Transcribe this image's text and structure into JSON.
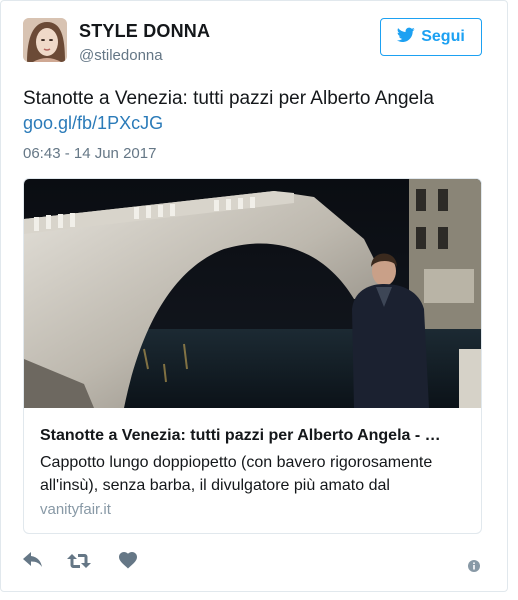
{
  "author": {
    "name": "STYLE DONNA",
    "handle": "@stiledonna"
  },
  "follow_button": {
    "label": "Segui",
    "icon": "twitter-bird-icon",
    "color": "#1da1f2"
  },
  "tweet": {
    "text": "Stanotte a Venezia: tutti pazzi per Alberto Angela",
    "link": "goo.gl/fb/1PXcJG",
    "timestamp": "06:43 - 14 Jun 2017"
  },
  "link_card": {
    "title": "Stanotte a Venezia: tutti pazzi per Alberto Angela - …",
    "description": "Cappotto lungo doppiopetto (con bavero rigorosamente all'insù), senza barba, il divulgatore più amato dal",
    "domain": "vanityfair.it"
  },
  "actions": [
    "reply-icon",
    "retweet-icon",
    "like-icon"
  ],
  "colors": {
    "link": "#2b7bb9",
    "secondary_text": "#657786",
    "icon": "#657786"
  }
}
